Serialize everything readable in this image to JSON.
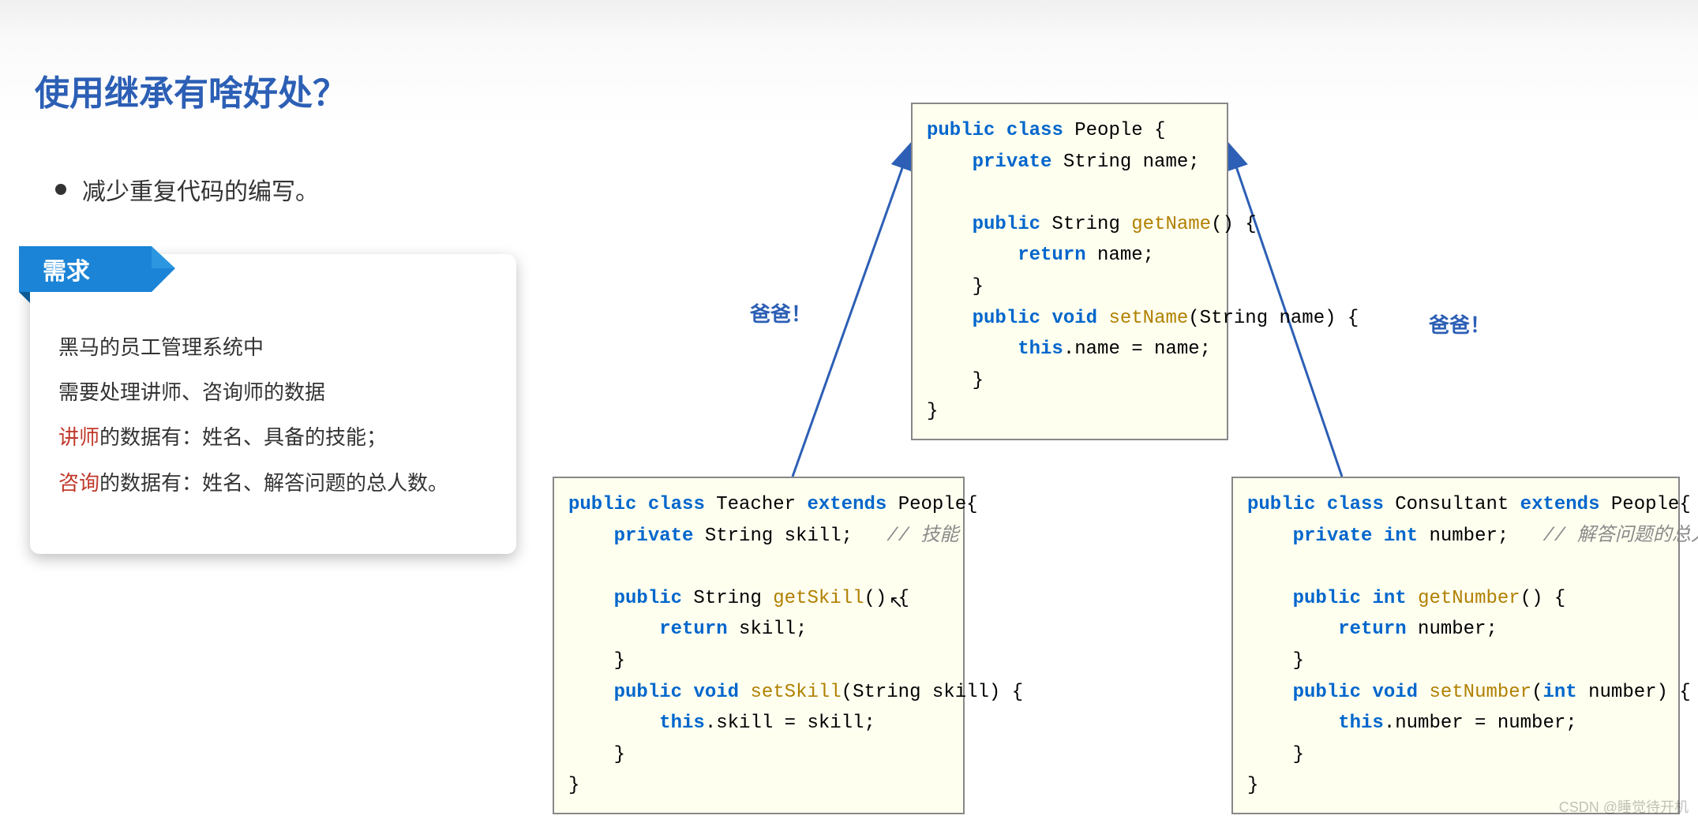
{
  "title": "使用继承有啥好处？",
  "bullet": "减少重复代码的编写。",
  "requirements": {
    "label": "需求",
    "line1": "黑马的员工管理系统中",
    "line2": "需要处理讲师、咨询师的数据",
    "line3a": "讲师",
    "line3b": "的数据有：姓名、具备的技能；",
    "line4a": "咨询",
    "line4b": "的数据有：姓名、解答问题的总人数。"
  },
  "arrow_labels": {
    "left": "爸爸！",
    "right": "爸爸！"
  },
  "code": {
    "people": {
      "l1a": "public",
      "l1b": "class",
      "l1c": " People {",
      "l2a": "private",
      "l2b": " String name;",
      "l3": "",
      "l4a": "public",
      "l4b": " String ",
      "l4c": "getName",
      "l4d": "() {",
      "l5a": "return",
      "l5b": " name;",
      "l6": "    }",
      "l7a": "public",
      "l7b": "void",
      "l7c": "setName",
      "l7d": "(String name) {",
      "l8a": "this",
      "l8b": ".name = name;",
      "l9": "    }",
      "l10": "}"
    },
    "teacher": {
      "l1a": "public",
      "l1b": "class",
      "l1c": " Teacher ",
      "l1d": "extends",
      "l1e": " People{",
      "l2a": "private",
      "l2b": " String skill;   ",
      "l2c": "// 技能",
      "l3": "",
      "l4a": "public",
      "l4b": " String ",
      "l4c": "getSkill",
      "l4d": "() {",
      "l5a": "return",
      "l5b": " skill;",
      "l6": "    }",
      "l7a": "public",
      "l7b": "void",
      "l7c": "setSkill",
      "l7d": "(String skill) {",
      "l8a": "this",
      "l8b": ".skill = skill;",
      "l9": "    }",
      "l10": "}"
    },
    "consultant": {
      "l1a": "public",
      "l1b": "class",
      "l1c": " Consultant ",
      "l1d": "extends",
      "l1e": " People{",
      "l2a": "private",
      "l2b": "int",
      "l2c": " number;   ",
      "l2d": "// 解答问题的总人数",
      "l3": "",
      "l4a": "public",
      "l4b": "int",
      "l4c": "getNumber",
      "l4d": "() {",
      "l5a": "return",
      "l5b": " number;",
      "l6": "    }",
      "l7a": "public",
      "l7b": "void",
      "l7c": "setNumber",
      "l7d": "(",
      "l7e": "int",
      "l7f": " number) {",
      "l8a": "this",
      "l8b": ".number = number;",
      "l9": "    }",
      "l10": "}"
    }
  },
  "watermark": "CSDN @睡觉待开机"
}
